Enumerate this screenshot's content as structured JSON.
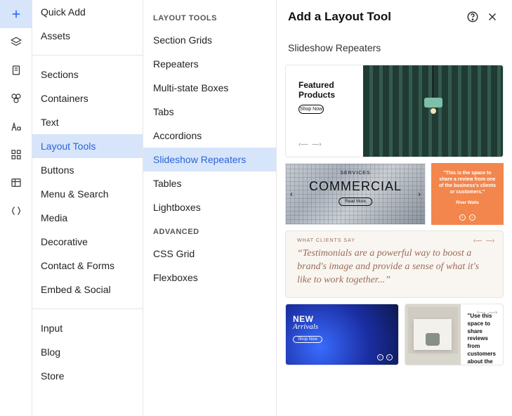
{
  "rail": [
    {
      "name": "add-icon",
      "active": true
    },
    {
      "name": "layers-icon",
      "active": false
    },
    {
      "name": "page-icon",
      "active": false
    },
    {
      "name": "theme-icon",
      "active": false
    },
    {
      "name": "content-icon",
      "active": false
    },
    {
      "name": "apps-icon",
      "active": false
    },
    {
      "name": "cms-icon",
      "active": false
    },
    {
      "name": "code-icon",
      "active": false
    }
  ],
  "col1": {
    "groups": [
      [
        "Quick Add",
        "Assets"
      ],
      [
        "Sections",
        "Containers",
        "Text",
        "Layout Tools",
        "Buttons",
        "Menu & Search",
        "Media",
        "Decorative",
        "Contact & Forms",
        "Embed & Social"
      ],
      [
        "Input",
        "Blog",
        "Store"
      ]
    ],
    "selected": "Layout Tools"
  },
  "col2": {
    "heading1": "LAYOUT TOOLS",
    "items1": [
      "Section Grids",
      "Repeaters",
      "Multi-state Boxes",
      "Tabs",
      "Accordions",
      "Slideshow Repeaters",
      "Tables",
      "Lightboxes"
    ],
    "heading2": "ADVANCED",
    "items2": [
      "CSS Grid",
      "Flexboxes"
    ],
    "selected": "Slideshow Repeaters"
  },
  "panel": {
    "title": "Add a Layout Tool",
    "subtitle": "Slideshow Repeaters"
  },
  "cards": {
    "c1": {
      "title": "Featured\nProducts",
      "btn": "Shop Now"
    },
    "c2a": {
      "kicker": "SERVICES",
      "title": "COMMERCIAL",
      "btn": "Read More"
    },
    "c2b": {
      "quote": "\"This is the space to share a review from one of the business's clients or customers.\"",
      "author": "River Watts"
    },
    "c3": {
      "label": "WHAT CLIENTS SAY",
      "quote": "“Testimonials are a powerful way to boost a brand's image and provide a sense of what it's like to work together...”"
    },
    "c4a": {
      "t1": "NEW",
      "t2": "Arrivals",
      "btn": "Shop Now"
    },
    "c4b": {
      "quote": "\"Use this space to share reviews from customers about the products or services offered.\""
    }
  }
}
